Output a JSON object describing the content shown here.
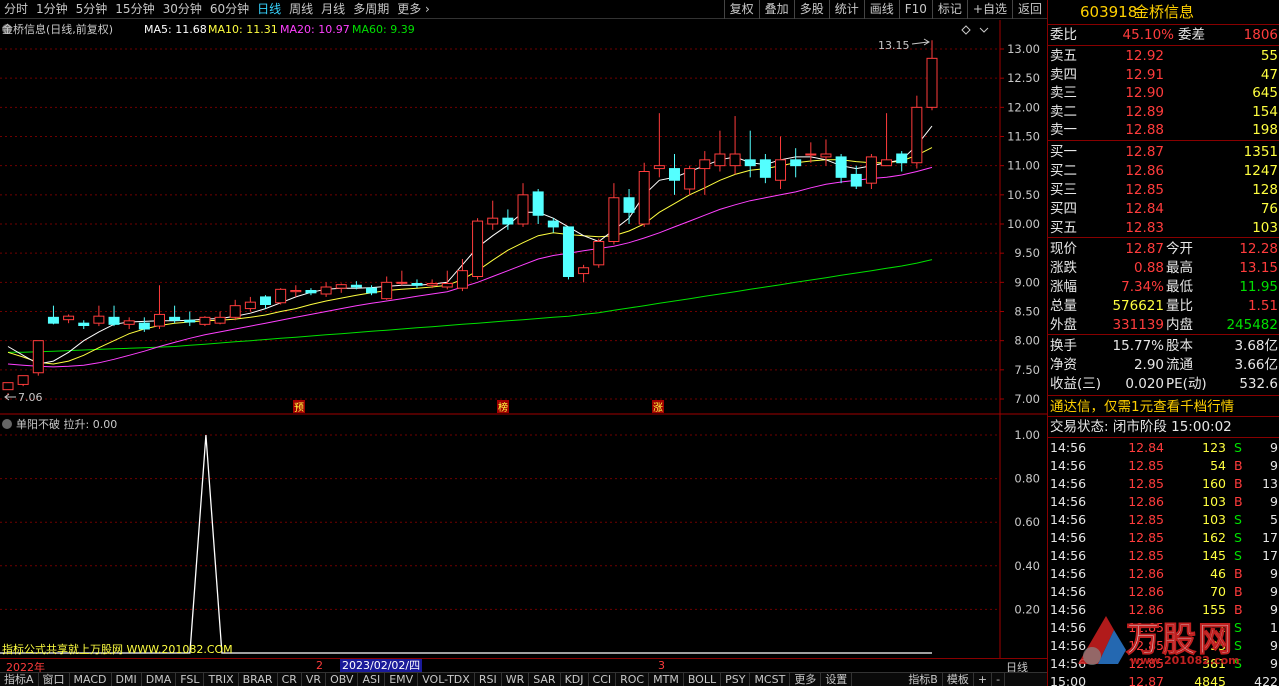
{
  "periods": [
    "分时",
    "1分钟",
    "5分钟",
    "15分钟",
    "30分钟",
    "60分钟",
    "日线",
    "周线",
    "月线",
    "多周期",
    "更多"
  ],
  "active_period": "日线",
  "tools": [
    "复权",
    "叠加",
    "多股",
    "统计",
    "画线",
    "F10",
    "标记",
    "+自选",
    "返回"
  ],
  "chart": {
    "title": "金桥信息(日线,前复权)",
    "ma": [
      {
        "label": "MA5: 11.68",
        "color": "#ffffff"
      },
      {
        "label": "MA10: 11.31",
        "color": "#ffff40"
      },
      {
        "label": "MA20: 10.97",
        "color": "#ff40ff"
      },
      {
        "label": "MA60: 9.39",
        "color": "#00e000"
      }
    ],
    "y_ticks": [
      "13.00",
      "12.50",
      "12.00",
      "11.50",
      "11.00",
      "10.50",
      "10.00",
      "9.50",
      "9.00",
      "8.50",
      "8.00",
      "7.50",
      "7.00"
    ],
    "high_label": "13.15",
    "low_label": "7.06",
    "markers": [
      "预",
      "榜",
      "涨"
    ]
  },
  "chart_data": {
    "type": "candlestick",
    "ylim": [
      6.9,
      13.25
    ],
    "candles": [
      [
        7.16,
        7.28,
        7.1,
        7.06
      ],
      [
        7.25,
        7.4,
        7.4,
        7.22
      ],
      [
        7.45,
        8.0,
        8.0,
        7.4
      ],
      [
        8.4,
        8.3,
        8.6,
        8.28
      ],
      [
        8.36,
        8.42,
        8.45,
        8.3
      ],
      [
        8.3,
        8.26,
        8.35,
        8.2
      ],
      [
        8.3,
        8.42,
        8.6,
        8.25
      ],
      [
        8.4,
        8.28,
        8.6,
        8.25
      ],
      [
        8.28,
        8.34,
        8.4,
        8.2
      ],
      [
        8.3,
        8.2,
        8.4,
        8.15
      ],
      [
        8.25,
        8.45,
        8.95,
        8.2
      ],
      [
        8.4,
        8.35,
        8.6,
        8.3
      ],
      [
        8.35,
        8.32,
        8.5,
        8.25
      ],
      [
        8.28,
        8.4,
        8.42,
        8.25
      ],
      [
        8.3,
        8.4,
        8.5,
        8.28
      ],
      [
        8.4,
        8.6,
        8.7,
        8.35
      ],
      [
        8.55,
        8.66,
        8.75,
        8.5
      ],
      [
        8.75,
        8.62,
        8.78,
        8.55
      ],
      [
        8.65,
        8.88,
        8.9,
        8.62
      ],
      [
        8.84,
        8.86,
        8.95,
        8.75
      ],
      [
        8.86,
        8.82,
        8.9,
        8.78
      ],
      [
        8.8,
        8.92,
        9.0,
        8.75
      ],
      [
        8.9,
        8.96,
        8.98,
        8.82
      ],
      [
        8.95,
        8.92,
        9.02,
        8.88
      ],
      [
        8.9,
        8.82,
        8.95,
        8.78
      ],
      [
        8.72,
        9.0,
        9.1,
        8.7
      ],
      [
        9.0,
        9.0,
        9.2,
        8.95
      ],
      [
        8.98,
        8.95,
        9.05,
        8.9
      ],
      [
        8.95,
        8.98,
        9.05,
        8.9
      ],
      [
        8.92,
        8.98,
        9.2,
        8.88
      ],
      [
        8.9,
        9.2,
        9.4,
        8.85
      ],
      [
        9.1,
        10.05,
        10.1,
        9.05
      ],
      [
        10.0,
        10.1,
        10.4,
        9.9
      ],
      [
        10.1,
        10.0,
        10.25,
        9.9
      ],
      [
        10.0,
        10.5,
        10.7,
        9.95
      ],
      [
        10.55,
        10.15,
        10.6,
        10.0
      ],
      [
        10.05,
        9.95,
        10.1,
        9.85
      ],
      [
        9.95,
        9.1,
        9.95,
        9.05
      ],
      [
        9.15,
        9.25,
        9.3,
        9.0
      ],
      [
        9.3,
        9.7,
        9.75,
        9.25
      ],
      [
        9.7,
        10.45,
        10.7,
        9.65
      ],
      [
        10.45,
        10.2,
        10.6,
        10.0
      ],
      [
        10.0,
        10.9,
        11.05,
        9.95
      ],
      [
        10.95,
        11.0,
        11.9,
        10.8
      ],
      [
        10.95,
        10.75,
        11.2,
        10.5
      ],
      [
        10.6,
        10.95,
        11.0,
        10.5
      ],
      [
        10.95,
        11.1,
        11.25,
        10.5
      ],
      [
        11.0,
        11.2,
        11.6,
        10.9
      ],
      [
        11.0,
        11.2,
        11.85,
        10.85
      ],
      [
        11.1,
        11.0,
        11.6,
        10.8
      ],
      [
        11.1,
        10.8,
        11.2,
        10.7
      ],
      [
        10.75,
        11.1,
        11.5,
        10.6
      ],
      [
        11.1,
        11.0,
        11.3,
        10.8
      ],
      [
        11.2,
        11.2,
        11.4,
        11.05
      ],
      [
        11.15,
        11.2,
        11.45,
        11.0
      ],
      [
        11.15,
        10.8,
        11.2,
        10.7
      ],
      [
        10.85,
        10.65,
        11.0,
        10.6
      ],
      [
        10.7,
        11.15,
        11.2,
        10.6
      ],
      [
        11.0,
        11.1,
        11.9,
        11.0
      ],
      [
        11.2,
        11.05,
        11.25,
        10.9
      ],
      [
        11.05,
        12.0,
        12.2,
        10.95
      ],
      [
        12.0,
        12.84,
        13.15,
        11.95
      ]
    ],
    "ma5": [
      7.9,
      7.75,
      7.6,
      7.65,
      7.8,
      8.0,
      8.15,
      8.28,
      8.32,
      8.33,
      8.34,
      8.34,
      8.35,
      8.37,
      8.38,
      8.42,
      8.47,
      8.55,
      8.65,
      8.75,
      8.83,
      8.88,
      8.9,
      8.9,
      8.91,
      8.93,
      8.95,
      8.95,
      8.97,
      9.0,
      9.3,
      9.6,
      9.8,
      9.98,
      10.2,
      10.2,
      10.1,
      9.95,
      9.8,
      9.7,
      9.9,
      10.1,
      10.5,
      10.75,
      10.8,
      10.9,
      11.0,
      11.1,
      11.15,
      11.05,
      11.02,
      11.1,
      11.15,
      11.15,
      11.1,
      11.0,
      10.95,
      11.0,
      11.05,
      11.1,
      11.35,
      11.68
    ],
    "ma10": [
      7.8,
      7.72,
      7.63,
      7.6,
      7.65,
      7.75,
      7.88,
      8.0,
      8.12,
      8.2,
      8.26,
      8.3,
      8.32,
      8.34,
      8.35,
      8.37,
      8.4,
      8.44,
      8.5,
      8.55,
      8.62,
      8.68,
      8.73,
      8.78,
      8.82,
      8.86,
      8.88,
      8.9,
      8.92,
      8.95,
      9.05,
      9.2,
      9.38,
      9.55,
      9.68,
      9.8,
      9.85,
      9.82,
      9.8,
      9.78,
      9.8,
      9.88,
      10.0,
      10.2,
      10.35,
      10.5,
      10.62,
      10.75,
      10.85,
      10.92,
      10.95,
      11.0,
      11.05,
      11.08,
      11.1,
      11.1,
      11.07,
      11.05,
      11.05,
      11.08,
      11.18,
      11.31
    ],
    "ma20": [
      7.6,
      7.58,
      7.56,
      7.55,
      7.56,
      7.58,
      7.62,
      7.68,
      7.75,
      7.82,
      7.9,
      7.97,
      8.04,
      8.1,
      8.15,
      8.2,
      8.25,
      8.3,
      8.35,
      8.4,
      8.45,
      8.5,
      8.55,
      8.6,
      8.64,
      8.68,
      8.72,
      8.76,
      8.8,
      8.84,
      8.92,
      9.0,
      9.1,
      9.2,
      9.3,
      9.4,
      9.46,
      9.5,
      9.54,
      9.58,
      9.62,
      9.68,
      9.76,
      9.85,
      9.95,
      10.05,
      10.15,
      10.25,
      10.33,
      10.4,
      10.45,
      10.5,
      10.55,
      10.62,
      10.68,
      10.72,
      10.75,
      10.78,
      10.8,
      10.84,
      10.9,
      10.97
    ],
    "ma60": [
      7.8,
      7.8,
      7.81,
      7.82,
      7.83,
      7.84,
      7.85,
      7.86,
      7.87,
      7.88,
      7.89,
      7.9,
      7.92,
      7.94,
      7.96,
      7.98,
      8.0,
      8.02,
      8.04,
      8.06,
      8.08,
      8.1,
      8.12,
      8.14,
      8.16,
      8.18,
      8.2,
      8.22,
      8.24,
      8.26,
      8.28,
      8.3,
      8.32,
      8.34,
      8.36,
      8.38,
      8.4,
      8.42,
      8.45,
      8.48,
      8.52,
      8.56,
      8.6,
      8.64,
      8.68,
      8.72,
      8.76,
      8.8,
      8.84,
      8.88,
      8.92,
      8.96,
      9.0,
      9.04,
      9.08,
      9.12,
      9.16,
      9.2,
      9.24,
      9.28,
      9.33,
      9.39
    ]
  },
  "indicator": {
    "title": "单阳不破 拉升: 0.00",
    "y_ticks": [
      "1.00",
      "0.80",
      "0.60",
      "0.40",
      "0.20"
    ],
    "spike_index": 13,
    "watermark": "指标公式共享就上万股网 WWW.201082.COM"
  },
  "timeline": {
    "year": "2022年",
    "m2": "2",
    "cursor_date": "2023/02/02/四",
    "m3": "3",
    "axis_label": "日线"
  },
  "tabs": [
    "指标A",
    "窗口",
    "MACD",
    "DMI",
    "DMA",
    "FSL",
    "TRIX",
    "BRAR",
    "CR",
    "VR",
    "OBV",
    "ASI",
    "EMV",
    "VOL-TDX",
    "RSI",
    "WR",
    "SAR",
    "KDJ",
    "CCI",
    "ROC",
    "MTM",
    "BOLL",
    "PSY",
    "MCST",
    "更多",
    "设置",
    "指标B",
    "模板",
    "+",
    "-"
  ],
  "quote": {
    "code": "603918",
    "name": "金桥信息",
    "weibi_label": "委比",
    "weibi": "45.10%",
    "weicha_label": "委差",
    "weicha": "1806",
    "sells": [
      {
        "label": "卖五",
        "price": "12.92",
        "vol": "55"
      },
      {
        "label": "卖四",
        "price": "12.91",
        "vol": "47"
      },
      {
        "label": "卖三",
        "price": "12.90",
        "vol": "645"
      },
      {
        "label": "卖二",
        "price": "12.89",
        "vol": "154"
      },
      {
        "label": "卖一",
        "price": "12.88",
        "vol": "198"
      }
    ],
    "buys": [
      {
        "label": "买一",
        "price": "12.87",
        "vol": "1351"
      },
      {
        "label": "买二",
        "price": "12.86",
        "vol": "1247"
      },
      {
        "label": "买三",
        "price": "12.85",
        "vol": "128"
      },
      {
        "label": "买四",
        "price": "12.84",
        "vol": "76"
      },
      {
        "label": "买五",
        "price": "12.83",
        "vol": "103"
      }
    ],
    "stats": [
      {
        "l1": "现价",
        "v1": "12.87",
        "c1": "red",
        "l2": "今开",
        "v2": "12.28",
        "c2": "red"
      },
      {
        "l1": "涨跌",
        "v1": "0.88",
        "c1": "red",
        "l2": "最高",
        "v2": "13.15",
        "c2": "red"
      },
      {
        "l1": "涨幅",
        "v1": "7.34%",
        "c1": "red",
        "l2": "最低",
        "v2": "11.95",
        "c2": "green"
      },
      {
        "l1": "总量",
        "v1": "576621",
        "c1": "yellow",
        "l2": "量比",
        "v2": "1.51",
        "c2": "red"
      },
      {
        "l1": "外盘",
        "v1": "331139",
        "c1": "red",
        "l2": "内盘",
        "v2": "245482",
        "c2": "green"
      }
    ],
    "stats2": [
      {
        "l1": "换手",
        "v1": "15.77%",
        "l2": "股本",
        "v2": "3.68亿"
      },
      {
        "l1": "净资",
        "v1": "2.90",
        "l2": "流通",
        "v2": "3.66亿"
      },
      {
        "l1": "收益(三)",
        "v1": "0.020",
        "l2": "PE(动)",
        "v2": "532.6"
      }
    ],
    "promo": "通达信，仅需1元查看千档行情",
    "status": "交易状态: 闭市阶段 15:00:02",
    "ticks": [
      {
        "t": "14:56",
        "p": "12.84",
        "v": "123",
        "d": "S",
        "n": "9"
      },
      {
        "t": "14:56",
        "p": "12.85",
        "v": "54",
        "d": "B",
        "n": "9"
      },
      {
        "t": "14:56",
        "p": "12.85",
        "v": "160",
        "d": "B",
        "n": "13"
      },
      {
        "t": "14:56",
        "p": "12.86",
        "v": "103",
        "d": "B",
        "n": "9"
      },
      {
        "t": "14:56",
        "p": "12.85",
        "v": "103",
        "d": "S",
        "n": "5"
      },
      {
        "t": "14:56",
        "p": "12.85",
        "v": "162",
        "d": "S",
        "n": "17"
      },
      {
        "t": "14:56",
        "p": "12.85",
        "v": "145",
        "d": "S",
        "n": "17"
      },
      {
        "t": "14:56",
        "p": "12.86",
        "v": "46",
        "d": "B",
        "n": "9"
      },
      {
        "t": "14:56",
        "p": "12.86",
        "v": "70",
        "d": "B",
        "n": "9"
      },
      {
        "t": "14:56",
        "p": "12.86",
        "v": "155",
        "d": "B",
        "n": "9"
      },
      {
        "t": "14:56",
        "p": "12.85",
        "v": "1",
        "d": "S",
        "n": "1"
      },
      {
        "t": "14:56",
        "p": "12.85",
        "v": "33",
        "d": "S",
        "n": "9"
      },
      {
        "t": "14:56",
        "p": "12.85",
        "v": "381",
        "d": "S",
        "n": "9"
      },
      {
        "t": "15:00",
        "p": "12.87",
        "v": "4845",
        "d": "",
        "n": "422"
      }
    ],
    "logo": "万股网",
    "logo_url": "www.201082.com"
  }
}
